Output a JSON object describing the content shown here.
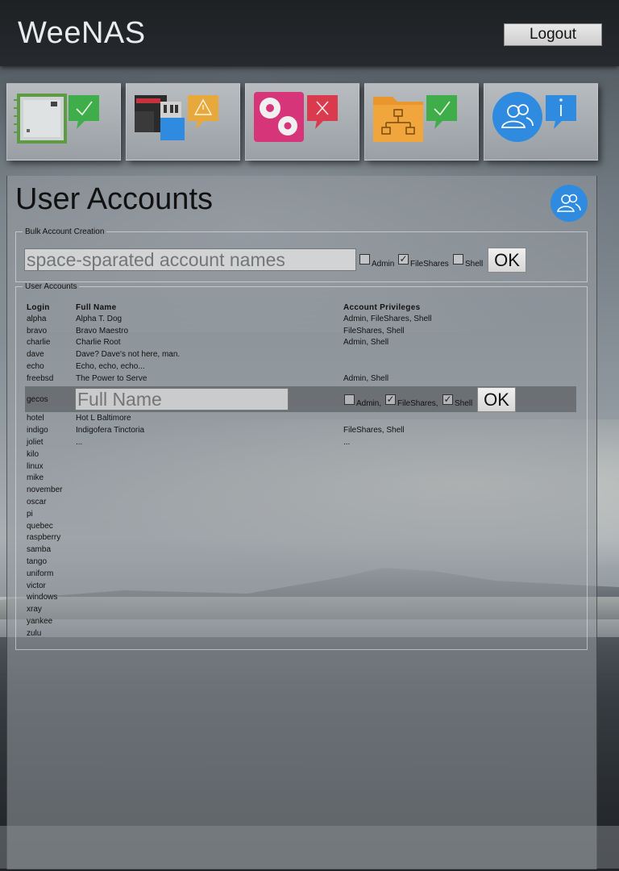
{
  "app": {
    "title": "WeeNAS",
    "logout_label": "Logout"
  },
  "tiles": [
    {
      "name": "system",
      "status": "ok"
    },
    {
      "name": "storage",
      "status": "warning"
    },
    {
      "name": "services",
      "status": "error"
    },
    {
      "name": "file-shares",
      "status": "ok"
    },
    {
      "name": "users",
      "status": "info"
    }
  ],
  "page": {
    "title": "User Accounts"
  },
  "bulk": {
    "legend": "Bulk Account Creation",
    "placeholder": "space-sparated account names",
    "admin_label": "Admin",
    "fileshares_label": "FileShares",
    "shell_label": "Shell",
    "admin_checked": false,
    "fileshares_checked": true,
    "shell_checked": false,
    "ok_label": "OK"
  },
  "accounts": {
    "legend": "User Accounts",
    "headers": {
      "login": "Login",
      "full_name": "Full Name",
      "privileges": "Account Privileges"
    },
    "rows": [
      {
        "login": "alpha",
        "full_name": "Alpha T. Dog",
        "privileges": "Admin, FileShares, Shell"
      },
      {
        "login": "bravo",
        "full_name": "Bravo Maestro",
        "privileges": "FileShares, Shell"
      },
      {
        "login": "charlie",
        "full_name": "Charlie Root",
        "privileges": "Admin, Shell"
      },
      {
        "login": "dave",
        "full_name": "Dave? Dave's not here, man.",
        "privileges": ""
      },
      {
        "login": "echo",
        "full_name": "Echo, echo, echo...",
        "privileges": ""
      },
      {
        "login": "freebsd",
        "full_name": "The Power to Serve",
        "privileges": "Admin, Shell"
      }
    ],
    "edit_row": {
      "login": "gecos",
      "full_name_placeholder": "Full Name",
      "admin_label": "Admin,",
      "fileshares_label": "FileShares,",
      "shell_label": "Shell",
      "admin_checked": false,
      "fileshares_checked": true,
      "shell_checked": true,
      "ok_label": "OK"
    },
    "rows_after": [
      {
        "login": "hotel",
        "full_name": "Hot L Baltimore",
        "privileges": ""
      },
      {
        "login": "indigo",
        "full_name": "Indigofera Tinctoria",
        "privileges": "FileShares, Shell"
      },
      {
        "login": "joliet",
        "full_name": "...",
        "privileges": "..."
      },
      {
        "login": "kilo",
        "full_name": "",
        "privileges": ""
      },
      {
        "login": "linux",
        "full_name": "",
        "privileges": ""
      },
      {
        "login": "mike",
        "full_name": "",
        "privileges": ""
      },
      {
        "login": "november",
        "full_name": "",
        "privileges": ""
      },
      {
        "login": "oscar",
        "full_name": "",
        "privileges": ""
      },
      {
        "login": "pi",
        "full_name": "",
        "privileges": ""
      },
      {
        "login": "quebec",
        "full_name": "",
        "privileges": ""
      },
      {
        "login": "raspberry",
        "full_name": "",
        "privileges": ""
      },
      {
        "login": "samba",
        "full_name": "",
        "privileges": ""
      },
      {
        "login": "tango",
        "full_name": "",
        "privileges": ""
      },
      {
        "login": "uniform",
        "full_name": "",
        "privileges": ""
      },
      {
        "login": "victor",
        "full_name": "",
        "privileges": ""
      },
      {
        "login": "windows",
        "full_name": "",
        "privileges": ""
      },
      {
        "login": "xray",
        "full_name": "",
        "privileges": ""
      },
      {
        "login": "yankee",
        "full_name": "",
        "privileges": ""
      },
      {
        "login": "zulu",
        "full_name": "",
        "privileges": ""
      }
    ]
  },
  "colors": {
    "ok": "#3fae4a",
    "warning": "#e8a93c",
    "error": "#d93a4e",
    "info": "#2e8be0",
    "services_pink": "#d6357a",
    "folder_orange": "#e9972d",
    "chip_green": "#6fb04e"
  }
}
